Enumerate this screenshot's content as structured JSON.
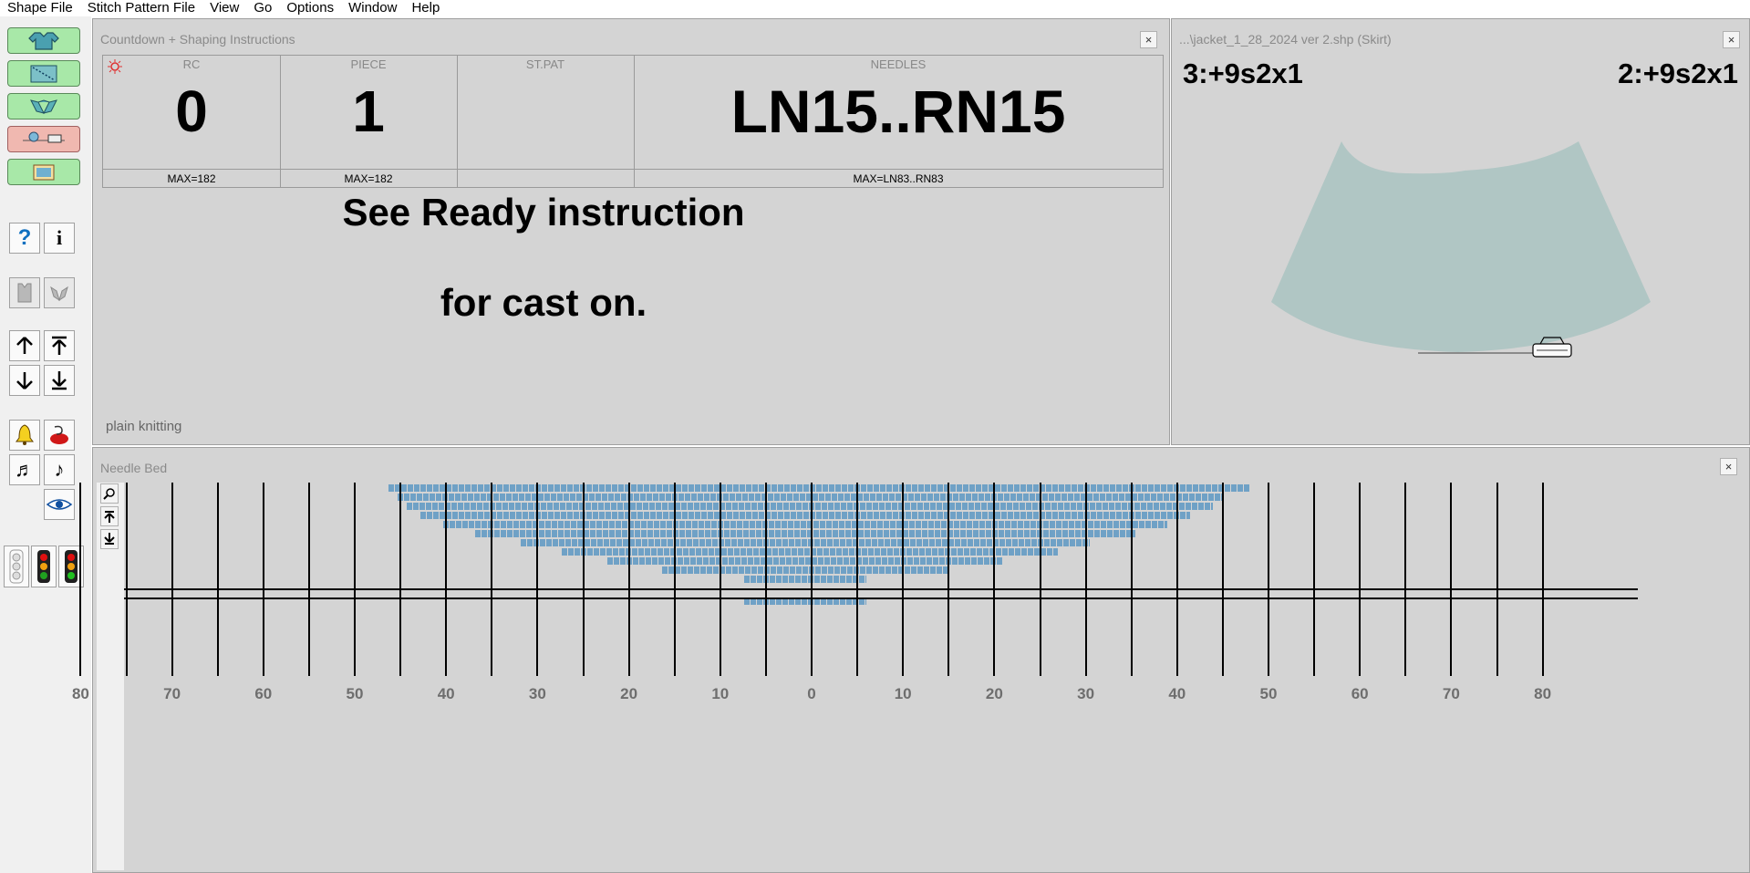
{
  "menu": [
    "Shape File",
    "Stitch Pattern File",
    "View",
    "Go",
    "Options",
    "Window",
    "Help"
  ],
  "icons": [
    "sweater-icon",
    "shaping-icon",
    "pieces-icon",
    "carriage-icon",
    "picture-icon",
    "help-icon",
    "info-icon",
    "front-icon",
    "back-icon",
    "up-arrow-icon",
    "top-arrow-icon",
    "down-arrow-icon",
    "bottom-arrow-icon",
    "bell-icon",
    "speech-icon",
    "music-note-double-icon",
    "music-note-icon",
    "eye-icon",
    "traffic-light-off-icon",
    "traffic-light-icon",
    "traffic-light-green-icon"
  ],
  "countdown": {
    "title": "Countdown + Shaping Instructions",
    "close": "×",
    "rc": {
      "head": "RC",
      "value": "0",
      "max": "MAX=182"
    },
    "piece": {
      "head": "PIECE",
      "value": "1",
      "max": "MAX=182"
    },
    "stpat": {
      "head": "ST.PAT",
      "value": "",
      "max": ""
    },
    "needles": {
      "head": "NEEDLES",
      "value": "LN15..RN15",
      "max": "MAX=LN83..RN83"
    },
    "instruction_line1": "See Ready instruction",
    "instruction_line2": "for cast on.",
    "status": "plain knitting"
  },
  "shape": {
    "title": "...\\jacket_1_28_2024 ver 2.shp (Skirt)",
    "close": "×",
    "left_note": "3:+9s2x1",
    "right_note": "2:+9s2x1",
    "shape_color": "#b0c6c4"
  },
  "needlebed": {
    "title": "Needle Bed",
    "close": "×",
    "stitch_color": "#6fa1c6",
    "labels": [
      "80",
      "70",
      "60",
      "50",
      "40",
      "30",
      "20",
      "10",
      "0",
      "10",
      "20",
      "30",
      "40",
      "50",
      "60",
      "70",
      "80"
    ]
  }
}
